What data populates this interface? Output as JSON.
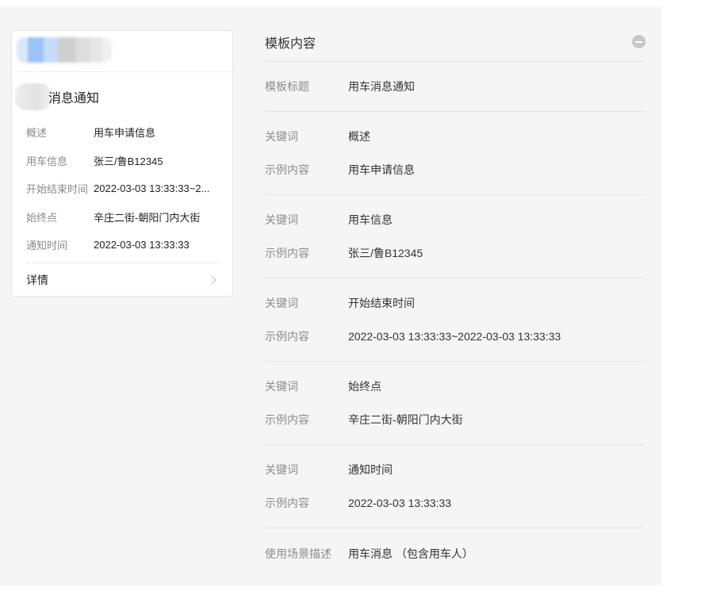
{
  "preview_card": {
    "mosaic_colors": [
      "#dbe8fb",
      "#9cc3f5",
      "#c6dcf8",
      "#cfcfcf",
      "#dddddd",
      "#e6e6e6",
      "#f0f0f0"
    ],
    "title": "消息通知",
    "fields": [
      {
        "key": "概述",
        "value": "用车申请信息"
      },
      {
        "key": "用车信息",
        "value": "张三/鲁B12345"
      },
      {
        "key": "开始结束时间",
        "value": "2022-03-03 13:33:33~2..."
      },
      {
        "key": "始终点",
        "value": "辛庄二街-朝阳门内大街"
      },
      {
        "key": "通知时间",
        "value": "2022-03-03 13:33:33"
      }
    ],
    "detail_label": "详情"
  },
  "template": {
    "heading": "模板内容",
    "title_key": "模板标题",
    "title_value": "用车消息通知",
    "keyword_label": "关键词",
    "example_label": "示例内容",
    "groups": [
      {
        "keyword": "概述",
        "example": "用车申请信息"
      },
      {
        "keyword": "用车信息",
        "example": "张三/鲁B12345"
      },
      {
        "keyword": "开始结束时间",
        "example": "2022-03-03 13:33:33~2022-03-03 13:33:33"
      },
      {
        "keyword": "始终点",
        "example": "辛庄二街-朝阳门内大街"
      },
      {
        "keyword": "通知时间",
        "example": "2022-03-03 13:33:33"
      }
    ],
    "scene_key": "使用场景描述",
    "scene_value": "用车消息 （包含用车人）"
  }
}
